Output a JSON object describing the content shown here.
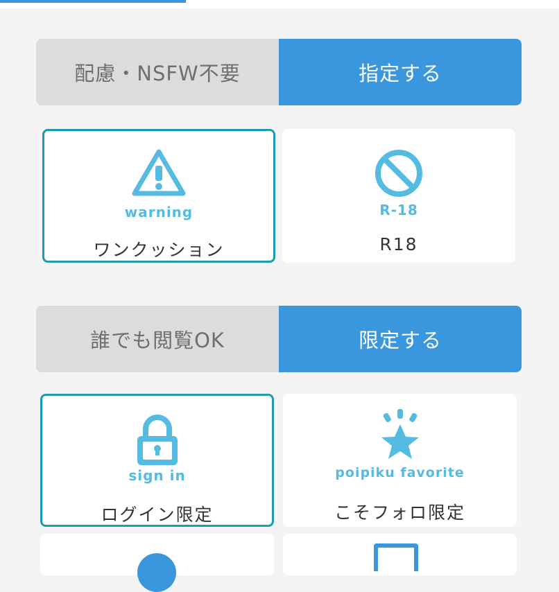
{
  "colors": {
    "accent": "#3a97dd",
    "selected_border": "#1c9bb1",
    "icon": "#55bbe0"
  },
  "nsfw_section": {
    "toggle_off_label": "配慮・NSFW不要",
    "toggle_on_label": "指定する",
    "options": [
      {
        "icon": "warning-icon",
        "icon_label": "warning",
        "label": "ワンクッション",
        "selected": true
      },
      {
        "icon": "r18-prohibited-icon",
        "icon_label": "R-18",
        "label": "R18",
        "selected": false
      }
    ]
  },
  "audience_section": {
    "toggle_off_label": "誰でも閲覧OK",
    "toggle_on_label": "限定する",
    "options": [
      {
        "icon": "lock-icon",
        "icon_label": "sign in",
        "label": "ログイン限定",
        "selected": true
      },
      {
        "icon": "star-icon",
        "icon_label": "poipiku favorite",
        "label": "こそフォロ限定",
        "selected": false
      }
    ]
  }
}
